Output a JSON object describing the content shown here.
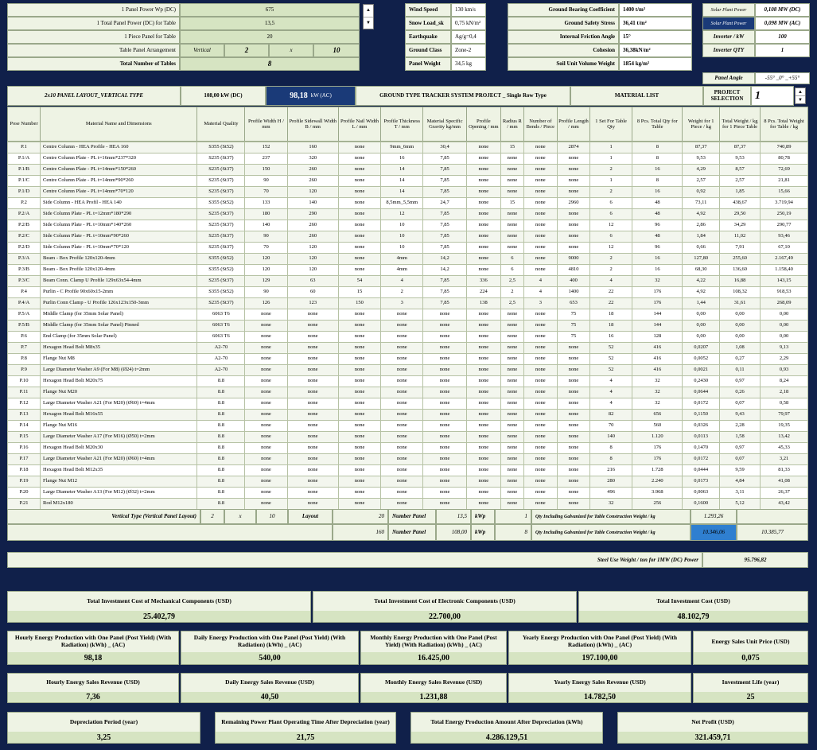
{
  "params_left": [
    {
      "label": "1 Panel Power Wp (DC)",
      "value": "675"
    },
    {
      "label": "1 Total Panel Power (DC) for Table",
      "value": "13,5"
    },
    {
      "label": "1 Piece Panel for Table",
      "value": "20"
    },
    {
      "label": "Table Panel Arrangement",
      "value": "Vertical",
      "a": "2",
      "x": "x",
      "b": "10"
    },
    {
      "label": "Total Number of Tables",
      "value": "8"
    }
  ],
  "params_mid": [
    {
      "label": "Wind Speed",
      "value": "130 km/s"
    },
    {
      "label": "Snow Load_sk",
      "value": "0,75 kN/m²"
    },
    {
      "label": "Earthquake",
      "value": "Ag/g=0,4"
    },
    {
      "label": "Ground Class",
      "value": "Zone-2"
    },
    {
      "label": "Panel Weight",
      "value": "34,5 kg"
    }
  ],
  "params_right": [
    {
      "label": "Ground Bearing Coefficient",
      "value": "1400 t/m³"
    },
    {
      "label": "Ground Safety Stress",
      "value": "36,41 t/m²"
    },
    {
      "label": "Internal Friction Angle",
      "value": "15°"
    },
    {
      "label": "Cohesion",
      "value": "36,38kN/m²"
    },
    {
      "label": "Soil Unit Volume Weight",
      "value": "1854 kg/m³"
    }
  ],
  "plant": [
    {
      "label": "Solar Plant Power",
      "value": "0,108 MW (DC)"
    },
    {
      "label": "Solar Plant Power",
      "value": "0,098 MW (AC)"
    },
    {
      "label": "Inverter / kW",
      "value": "100"
    },
    {
      "label": "Inverter QTY",
      "value": "1"
    }
  ],
  "panel_angle": {
    "label": "Panel Angle",
    "value": "-55° _0° _+55°"
  },
  "title_bar": {
    "layout": "2x10 PANEL LAYOUT_VERTICAL TYPE",
    "dc": "108,00  kW (DC)",
    "ac_value": "98,18",
    "ac_unit": "kW (AC)",
    "project": "GROUND TYPE TRACKER SYSTEM PROJECT _ Single Row Type",
    "material_list": "MATERIAL LIST",
    "selection_label": "PROJECT SELECTION",
    "selection_value": "1"
  },
  "columns": [
    "Pose Number",
    "Material Name and Dimensions",
    "Material Quality",
    "Profile Width H / mm",
    "Profile Sidewall Width B / mm",
    "Profile Nail Width L / mm",
    "Profile Thickness T / mm",
    "Material Specific Gravity kg/mm",
    "Profile Opening / mm",
    "Radius R / mm",
    "Number of Bends / Piece",
    "Profile Length / mm",
    "1 Set For Table Qty",
    "8 Pcs. Total Qty for Table",
    "Weight for 1 Piece / kg",
    "Total Weight / kg for 1 Piece Table",
    "8 Pcs. Total Weight for Table / kg"
  ],
  "rows": [
    [
      "P.1",
      "Centre Column - HEA Profile - HEA 160",
      "S355 (St52)",
      "152",
      "160",
      "none",
      "9mm_6mm",
      "30,4",
      "none",
      "15",
      "none",
      "2874",
      "1",
      "8",
      "87,37",
      "87,37",
      "740,89"
    ],
    [
      "P.1/A",
      "Centre Column Plate - PL t=16mm*237*320",
      "S235 (St37)",
      "237",
      "320",
      "none",
      "16",
      "7,85",
      "none",
      "none",
      "none",
      "none",
      "1",
      "8",
      "9,53",
      "9,53",
      "80,78"
    ],
    [
      "P.1/B",
      "Centre Column Plate - PL t=14mm*150*260",
      "S235 (St37)",
      "150",
      "260",
      "none",
      "14",
      "7,85",
      "none",
      "none",
      "none",
      "none",
      "2",
      "16",
      "4,29",
      "8,57",
      "72,69"
    ],
    [
      "P.1/C",
      "Centre Column Plate - PL t=14mm*90*260",
      "S235 (St37)",
      "90",
      "260",
      "none",
      "14",
      "7,85",
      "none",
      "none",
      "none",
      "none",
      "1",
      "8",
      "2,57",
      "2,57",
      "21,81"
    ],
    [
      "P.1/D",
      "Centre Column Plate - PL t=14mm*70*120",
      "S235 (St37)",
      "70",
      "120",
      "none",
      "14",
      "7,85",
      "none",
      "none",
      "none",
      "none",
      "2",
      "16",
      "0,92",
      "1,85",
      "15,66"
    ],
    [
      "P.2",
      "Side Column - HEA Profil - HEA 140",
      "S355 (St52)",
      "133",
      "140",
      "none",
      "8,5mm_5,5mm",
      "24,7",
      "none",
      "15",
      "none",
      "2960",
      "6",
      "48",
      "73,11",
      "438,67",
      "3.719,94"
    ],
    [
      "P.2/A",
      "Side Column Plate - PL t=12mm*180*290",
      "S235 (St37)",
      "180",
      "290",
      "none",
      "12",
      "7,85",
      "none",
      "none",
      "none",
      "none",
      "6",
      "48",
      "4,92",
      "29,50",
      "250,19"
    ],
    [
      "P.2/B",
      "Side Column Plate - PL t=10mm*140*260",
      "S235 (St37)",
      "140",
      "260",
      "none",
      "10",
      "7,85",
      "none",
      "none",
      "none",
      "none",
      "12",
      "96",
      "2,86",
      "34,29",
      "290,77"
    ],
    [
      "P.2/C",
      "Side Column Plate - PL t=10mm*90*260",
      "S235 (St37)",
      "90",
      "260",
      "none",
      "10",
      "7,85",
      "none",
      "none",
      "none",
      "none",
      "6",
      "48",
      "1,84",
      "11,02",
      "93,46"
    ],
    [
      "P.2/D",
      "Side Column Plate - PL t=10mm*70*120",
      "S235 (St37)",
      "70",
      "120",
      "none",
      "10",
      "7,85",
      "none",
      "none",
      "none",
      "none",
      "12",
      "96",
      "0,66",
      "7,91",
      "67,10"
    ],
    [
      "P.3/A",
      "Beam - Box Profile 120x120-4mm",
      "S355 (St52)",
      "120",
      "120",
      "none",
      "4mm",
      "14,2",
      "none",
      "6",
      "none",
      "9000",
      "2",
      "16",
      "127,80",
      "255,60",
      "2.167,49"
    ],
    [
      "P.3/B",
      "Beam - Box Profile 120x120-4mm",
      "S355 (St52)",
      "120",
      "120",
      "none",
      "4mm",
      "14,2",
      "none",
      "6",
      "none",
      "4810",
      "2",
      "16",
      "68,30",
      "136,60",
      "1.158,40"
    ],
    [
      "P.3/C",
      "Beam Conn. Clamp U Profile 129x63x54-4mm",
      "S235 (St37)",
      "129",
      "63",
      "54",
      "4",
      "7,85",
      "336",
      "2,5",
      "4",
      "400",
      "4",
      "32",
      "4,22",
      "16,88",
      "143,15"
    ],
    [
      "P.4",
      "Purlin - C Profile 90x60x15-2mm",
      "S355 (St52)",
      "90",
      "60",
      "15",
      "2",
      "7,85",
      "224",
      "2",
      "4",
      "1400",
      "22",
      "176",
      "4,92",
      "108,32",
      "918,53"
    ],
    [
      "P.4/A",
      "Purlin Conn Clamp - U Profile 126x123x150-3mm",
      "S235 (St37)",
      "126",
      "123",
      "150",
      "3",
      "7,85",
      "138",
      "2,5",
      "3",
      "653",
      "22",
      "176",
      "1,44",
      "31,61",
      "268,09"
    ],
    [
      "P.5/A",
      "Middle Clamp (for 35mm Solar Panel)",
      "6063 T6",
      "none",
      "none",
      "none",
      "none",
      "none",
      "none",
      "none",
      "none",
      "75",
      "18",
      "144",
      "0,00",
      "0,00",
      "0,00"
    ],
    [
      "P.5/B",
      "Middle Clamp (for 35mm Solar Panel) Pinned",
      "6063 T6",
      "none",
      "none",
      "none",
      "none",
      "none",
      "none",
      "none",
      "none",
      "75",
      "18",
      "144",
      "0,00",
      "0,00",
      "0,00"
    ],
    [
      "P.6",
      "End Clamp (for 35mm Solar Panel)",
      "6063 T6",
      "none",
      "none",
      "none",
      "none",
      "none",
      "none",
      "none",
      "none",
      "75",
      "16",
      "128",
      "0,00",
      "0,00",
      "0,00"
    ],
    [
      "P.7",
      "Hexagon Head Bolt M8x35",
      "A2-70",
      "none",
      "none",
      "none",
      "none",
      "none",
      "none",
      "none",
      "none",
      "none",
      "52",
      "416",
      "0,0207",
      "1,08",
      "9,13"
    ],
    [
      "P.8",
      "Flange Nut M8",
      "A2-70",
      "none",
      "none",
      "none",
      "none",
      "none",
      "none",
      "none",
      "none",
      "none",
      "52",
      "416",
      "0,0052",
      "0,27",
      "2,29"
    ],
    [
      "P.9",
      "Large Diameter Washer A9 (For M8) (Ø24) t=2mm",
      "A2-70",
      "none",
      "none",
      "none",
      "none",
      "none",
      "none",
      "none",
      "none",
      "none",
      "52",
      "416",
      "0,0021",
      "0,11",
      "0,93"
    ],
    [
      "P.10",
      "Hexagon Head Bolt M20x75",
      "8.8",
      "none",
      "none",
      "none",
      "none",
      "none",
      "none",
      "none",
      "none",
      "none",
      "4",
      "32",
      "0,2430",
      "0,97",
      "8,24"
    ],
    [
      "P.11",
      "Flange Nut M20",
      "8.8",
      "none",
      "none",
      "none",
      "none",
      "none",
      "none",
      "none",
      "none",
      "none",
      "4",
      "32",
      "0,0644",
      "0,26",
      "2,18"
    ],
    [
      "P.12",
      "Large Diameter Washer A21 (For M20) (Ø60) t=4mm",
      "8.8",
      "none",
      "none",
      "none",
      "none",
      "none",
      "none",
      "none",
      "none",
      "none",
      "4",
      "32",
      "0,0172",
      "0,07",
      "0,58"
    ],
    [
      "P.13",
      "Hexagon Head Bolt M16x55",
      "8.8",
      "none",
      "none",
      "none",
      "none",
      "none",
      "none",
      "none",
      "none",
      "none",
      "82",
      "656",
      "0,1150",
      "9,43",
      "79,97"
    ],
    [
      "P.14",
      "Flange Nut M16",
      "8.8",
      "none",
      "none",
      "none",
      "none",
      "none",
      "none",
      "none",
      "none",
      "none",
      "70",
      "560",
      "0,0326",
      "2,28",
      "19,35"
    ],
    [
      "P.15",
      "Large Diameter Washer A17 (For M16) (Ø50) t=2mm",
      "8.8",
      "none",
      "none",
      "none",
      "none",
      "none",
      "none",
      "none",
      "none",
      "none",
      "140",
      "1.120",
      "0,0113",
      "1,58",
      "13,42"
    ],
    [
      "P.16",
      "Hexagon Head Bolt M20x30",
      "8.8",
      "none",
      "none",
      "none",
      "none",
      "none",
      "none",
      "none",
      "none",
      "none",
      "8",
      "176",
      "0,1470",
      "0,97",
      "45,33"
    ],
    [
      "P.17",
      "Large Diameter Washer A21 (For M20) (Ø60) t=4mm",
      "8.8",
      "none",
      "none",
      "none",
      "none",
      "none",
      "none",
      "none",
      "none",
      "none",
      "8",
      "176",
      "0,0172",
      "0,07",
      "3,21"
    ],
    [
      "P.18",
      "Hexagon Head Bolt M12x35",
      "8.8",
      "none",
      "none",
      "none",
      "none",
      "none",
      "none",
      "none",
      "none",
      "none",
      "216",
      "1.728",
      "0,0444",
      "9,59",
      "81,33"
    ],
    [
      "P.19",
      "Flange Nut M12",
      "8.8",
      "none",
      "none",
      "none",
      "none",
      "none",
      "none",
      "none",
      "none",
      "none",
      "280",
      "2.240",
      "0,0173",
      "4,84",
      "41,08"
    ],
    [
      "P.20",
      "Large Diameter Washer A13 (For M12) (Ø32) t=2mm",
      "8.8",
      "none",
      "none",
      "none",
      "none",
      "none",
      "none",
      "none",
      "none",
      "none",
      "496",
      "3.968",
      "0,0063",
      "3,11",
      "26,37"
    ],
    [
      "P.21",
      "Rod M12x180",
      "8.8",
      "none",
      "none",
      "none",
      "none",
      "none",
      "none",
      "none",
      "none",
      "none",
      "32",
      "256",
      "0,1600",
      "5,12",
      "43,42"
    ]
  ],
  "footer1": {
    "type": "Vertical Type (Vertical Panel Layout)",
    "a": "2",
    "x": "x",
    "b": "10",
    "layout": "Layout",
    "panels": "20",
    "panels_label": "Number Panel",
    "kwp": "13,5",
    "kwp_unit": "kWp",
    "qty": "1",
    "qty_label": "Qty Including Galvanized for Table Construction Weight / kg",
    "weight": "1.293,26"
  },
  "footer2": {
    "panels": "160",
    "panels_label": "Number Panel",
    "kwp": "108,00",
    "kwp_unit": "kWp",
    "qty": "8",
    "qty_label": "Qty Including Galvanized for Table Construction Weight / kg",
    "weight": "10.346,06",
    "total": "10.385,77"
  },
  "steel_use": {
    "label": "Steel Use Weight / ton for 1MW (DC) Power",
    "value": "95.796,82"
  },
  "investment": [
    {
      "label": "Total Investment Cost of Mechanical Components (USD)",
      "value": "25.402,79"
    },
    {
      "label": "Total Investment Cost of Electronic Components (USD)",
      "value": "22.700,00"
    },
    {
      "label": "Total Investment Cost (USD)",
      "value": "48.102,79"
    }
  ],
  "energy": [
    {
      "label": "Hourly Energy Production with One Panel (Post Yield) (With Radiation) (kWh) _ (AC)",
      "value": "98,18"
    },
    {
      "label": "Daily Energy Production with One Panel (Post Yield) (With Radiation) (kWh) _ (AC)",
      "value": "540,00"
    },
    {
      "label": "Monthly Energy Production with One Panel (Post Yield) (With Radiation) (kWh) _ (AC)",
      "value": "16.425,00"
    },
    {
      "label": "Yearly Energy Production with One Panel (Post Yield) (With Radiation) (kWh) _ (AC)",
      "value": "197.100,00"
    },
    {
      "label": "Energy Sales Unit Price (USD)",
      "value": "0,075"
    }
  ],
  "revenue": [
    {
      "label": "Hourly Energy Sales Revenue (USD)",
      "value": "7,36"
    },
    {
      "label": "Daily Energy Sales Revenue (USD)",
      "value": "40,50"
    },
    {
      "label": "Monthly Energy Sales Revenue (USD)",
      "value": "1.231,88"
    },
    {
      "label": "Yearly Energy Sales Revenue (USD)",
      "value": "14.782,50"
    },
    {
      "label": "Investment Life (year)",
      "value": "25"
    }
  ],
  "final": [
    {
      "label": "Depreciation Period (year)",
      "value": "3,25"
    },
    {
      "label": "Remaining Power Plant Operating Time After Depreciation (year)",
      "value": "21,75"
    },
    {
      "label": "Total Energy Production Amount After Depreciation (kWh)",
      "value": "4.286.129,51"
    },
    {
      "label": "Net Profit (USD)",
      "value": "321.459,71"
    }
  ],
  "colors": {
    "background": "#10204a",
    "cell": "#eef3e4",
    "value": "#d6e4c2",
    "highlight": "#2f7fd0",
    "accent": "#1a3a78"
  }
}
